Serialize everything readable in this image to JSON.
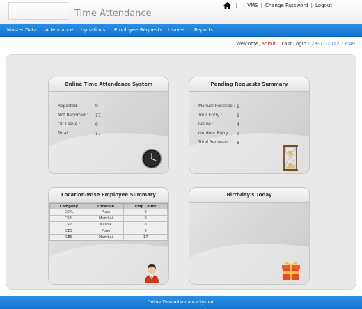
{
  "header": {
    "title": "Time Attendance",
    "links": {
      "vms": "VMS",
      "change_password": "Change Password",
      "logout": "Logout"
    }
  },
  "nav": {
    "items": [
      "Master Data",
      "Attendance",
      "Updations",
      "Employee Requests",
      "Leaves",
      "Reports"
    ]
  },
  "welcome": {
    "prefix": "Welcome,",
    "user": "admin",
    "last_login_label": "Last Login :",
    "last_login_value": "23-07-2012 17:49"
  },
  "panels": {
    "ota": {
      "title": "Online Time Attendance System",
      "rows": [
        {
          "label": "Reported :",
          "value": "0"
        },
        {
          "label": "Not Reported :",
          "value": "17"
        },
        {
          "label": "On Leave :",
          "value": "0"
        },
        {
          "label": "Total :",
          "value": "17"
        }
      ]
    },
    "pending": {
      "title": "Pending Requests Summary",
      "rows": [
        {
          "label": "Manual Punches :",
          "value": "1"
        },
        {
          "label": "Tour Entry :",
          "value": "1"
        },
        {
          "label": "Leave :",
          "value": "4"
        },
        {
          "label": "Outdoor Entry :",
          "value": "0"
        },
        {
          "label": "Total Requests :",
          "value": "6"
        }
      ]
    },
    "location": {
      "title": "Location-Wise Employee Summary",
      "columns": [
        "Company",
        "Location",
        "Emp Count"
      ],
      "rows": [
        [
          "CSPL",
          "Pune",
          "0"
        ],
        [
          "CSPL",
          "Mumbai",
          "0"
        ],
        [
          "CSPL",
          "Nashik",
          "0"
        ],
        [
          "CES",
          "Pune",
          "0"
        ],
        [
          "CES",
          "Mumbai",
          "17"
        ]
      ]
    },
    "birthday": {
      "title": "Birthday's Today"
    }
  },
  "footer": {
    "text": "Online Time Attendance System"
  },
  "icons": [
    "home-icon",
    "clock-icon",
    "hourglass-icon",
    "employee-icon",
    "gift-icon"
  ],
  "colors": {
    "nav": "#1a7fd8",
    "user": "#d02020",
    "date": "#2a7bd0"
  }
}
